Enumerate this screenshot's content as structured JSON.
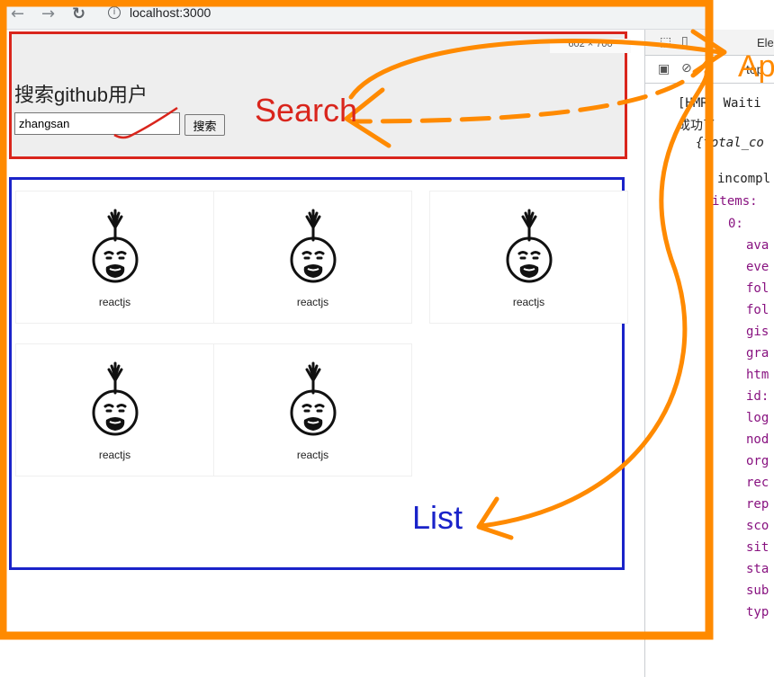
{
  "browser": {
    "back_icon": "←",
    "forward_icon": "→",
    "reload_icon": "↻",
    "url": "localhost:3000"
  },
  "viewport_badge": "602 × 700",
  "search": {
    "title": "搜索github用户",
    "input_value": "zhangsan",
    "button_label": "搜索"
  },
  "list": {
    "users": [
      {
        "login": "reactjs"
      },
      {
        "login": "reactjs"
      },
      {
        "login": "reactjs"
      },
      {
        "login": "reactjs"
      },
      {
        "login": "reactjs"
      }
    ]
  },
  "annotations": {
    "search_label": "Search",
    "list_label": "List",
    "app_label": "App",
    "colors": {
      "search": "#d9251c",
      "list": "#1a23c9",
      "app": "#ff8a00"
    }
  },
  "devtools": {
    "tab_label": "Ele",
    "context": "top",
    "lines": [
      "[HMR] Waiti",
      "成功了",
      "{total_co",
      "incompl",
      "items:",
      "0:",
      "ava",
      "eve",
      "fol",
      "fol",
      "gis",
      "gra",
      "htm",
      "id:",
      "log",
      "nod",
      "org",
      "rec",
      "rep",
      "sco",
      "sit",
      "sta",
      "sub",
      "typ"
    ]
  }
}
